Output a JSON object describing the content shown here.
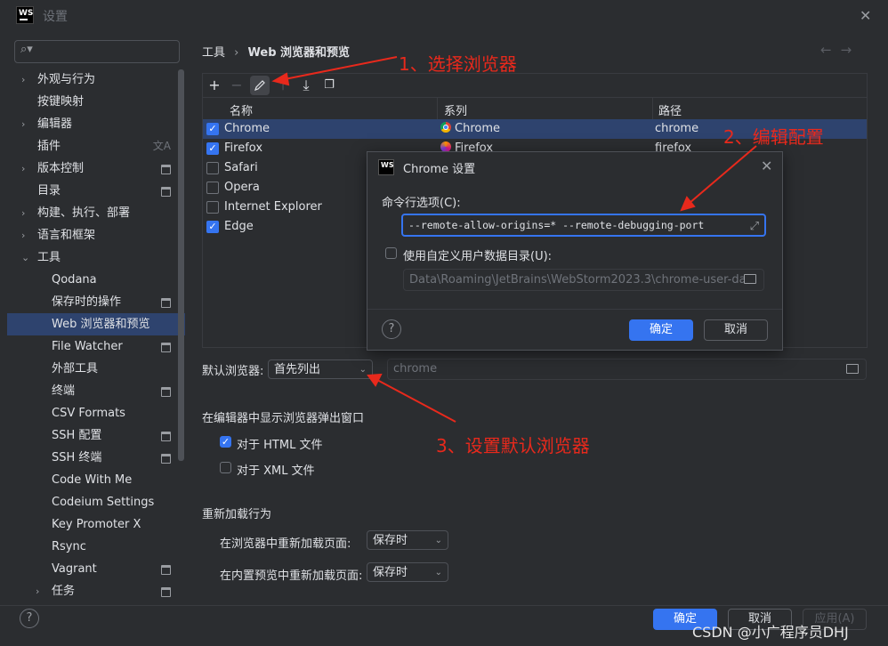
{
  "window": {
    "title": "设置",
    "logo": "WS"
  },
  "search": {
    "placeholder": ""
  },
  "sidebar": {
    "items": [
      {
        "label": "外观与行为",
        "expandable": true,
        "indent": 0
      },
      {
        "label": "按键映射",
        "expandable": false,
        "indent": 0
      },
      {
        "label": "编辑器",
        "expandable": true,
        "indent": 0
      },
      {
        "label": "插件",
        "expandable": false,
        "indent": 0,
        "icon": "translate-icon"
      },
      {
        "label": "版本控制",
        "expandable": true,
        "indent": 0,
        "icon": "project-badge-icon"
      },
      {
        "label": "目录",
        "expandable": false,
        "indent": 0,
        "icon": "project-badge-icon"
      },
      {
        "label": "构建、执行、部署",
        "expandable": true,
        "indent": 0
      },
      {
        "label": "语言和框架",
        "expandable": true,
        "indent": 0
      },
      {
        "label": "工具",
        "expandable": true,
        "expanded": true,
        "indent": 0
      },
      {
        "label": "Qodana",
        "indent": 1
      },
      {
        "label": "保存时的操作",
        "indent": 1,
        "icon": "project-badge-icon"
      },
      {
        "label": "Web 浏览器和预览",
        "indent": 1,
        "selected": true
      },
      {
        "label": "File Watcher",
        "indent": 1,
        "icon": "project-badge-icon"
      },
      {
        "label": "外部工具",
        "indent": 1
      },
      {
        "label": "终端",
        "indent": 1,
        "icon": "project-badge-icon"
      },
      {
        "label": "CSV Formats",
        "indent": 1
      },
      {
        "label": "SSH 配置",
        "indent": 1,
        "icon": "project-badge-icon"
      },
      {
        "label": "SSH 终端",
        "indent": 1,
        "icon": "project-badge-icon"
      },
      {
        "label": "Code With Me",
        "indent": 1
      },
      {
        "label": "Codeium Settings",
        "indent": 1
      },
      {
        "label": "Key Promoter X",
        "indent": 1
      },
      {
        "label": "Rsync",
        "indent": 1
      },
      {
        "label": "Vagrant",
        "indent": 1,
        "icon": "project-badge-icon"
      },
      {
        "label": "任务",
        "indent": 1,
        "expandable": true,
        "icon": "project-badge-icon"
      }
    ]
  },
  "breadcrumb": {
    "parent": "工具",
    "separator": "›",
    "current": "Web 浏览器和预览"
  },
  "browsers_table": {
    "columns": [
      "名称",
      "系列",
      "路径"
    ],
    "rows": [
      {
        "checked": true,
        "name": "Chrome",
        "family": "Chrome",
        "family_icon": "chrome-icon",
        "path": "chrome",
        "selected": true
      },
      {
        "checked": true,
        "name": "Firefox",
        "family": "Firefox",
        "family_icon": "firefox-icon",
        "path": "firefox"
      },
      {
        "checked": false,
        "name": "Safari",
        "family": "",
        "path": ""
      },
      {
        "checked": false,
        "name": "Opera",
        "family": "",
        "path": ""
      },
      {
        "checked": false,
        "name": "Internet Explorer",
        "family": "",
        "path": ""
      },
      {
        "checked": true,
        "name": "Edge",
        "family": "",
        "path": ""
      }
    ]
  },
  "default_browser": {
    "label": "默认浏览器:",
    "value": "首先列出",
    "path_placeholder": "chrome"
  },
  "popup_section": {
    "title": "在编辑器中显示浏览器弹出窗口",
    "html_label": "对于 HTML 文件",
    "html_checked": true,
    "xml_label": "对于 XML 文件",
    "xml_checked": false
  },
  "reload_section": {
    "title": "重新加载行为",
    "browser_label": "在浏览器中重新加载页面:",
    "browser_value": "保存时",
    "builtin_label": "在内置预览中重新加载页面:",
    "builtin_value": "保存时"
  },
  "dialog": {
    "title": "Chrome 设置",
    "cmd_label": "命令行选项(C):",
    "cmd_value": "--remote-allow-origins=* --remote-debugging-port",
    "custom_dir_label": "使用自定义用户数据目录(U):",
    "custom_dir_checked": false,
    "custom_dir_value": "Data\\Roaming\\JetBrains\\WebStorm2023.3\\chrome-user-da",
    "ok": "确定",
    "cancel": "取消"
  },
  "footer": {
    "ok": "确定",
    "cancel": "取消",
    "apply": "应用(A)"
  },
  "annotations": {
    "a1": "1、选择浏览器",
    "a2": "2、编辑配置",
    "a3": "3、设置默认浏览器",
    "color": "#e8291c"
  },
  "watermark": "CSDN @小广程序员DHJ",
  "colors": {
    "accent": "#3574f0",
    "background": "#2b2d30",
    "selection": "#2e436e"
  }
}
